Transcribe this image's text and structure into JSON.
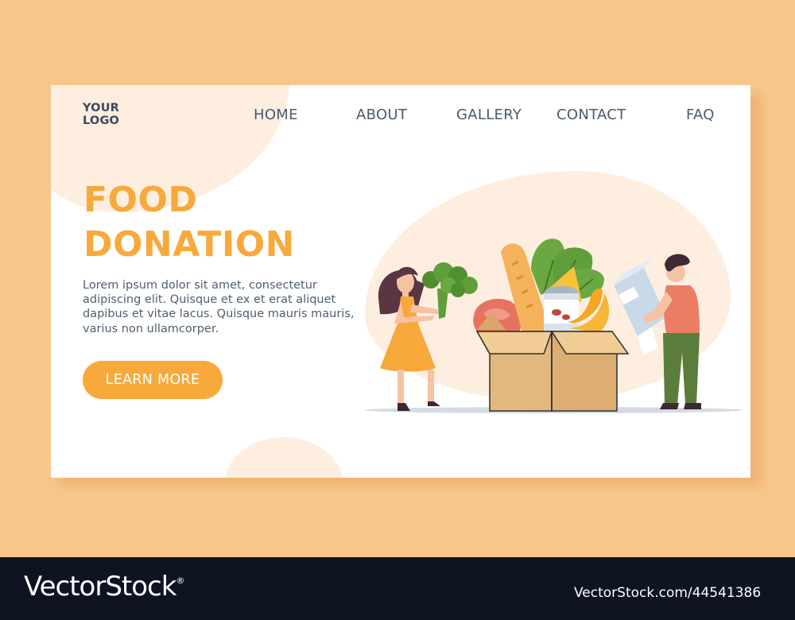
{
  "brand": {
    "logo_line1": "YOUR",
    "logo_line2": "LOGO"
  },
  "nav": {
    "home": "HOME",
    "about": "ABOUT",
    "gallery": "GALLERY",
    "contact": "CONTACT",
    "faq": "FAQ"
  },
  "hero": {
    "title_line1": "FOOD",
    "title_line2": "DONATION",
    "body": "Lorem ipsum dolor sit amet, consectetur adipiscing elit. Quisque et ex et erat aliquet dapibus et vitae lacus. Quisque mauris mauris, varius non ullamcorper.",
    "cta_label": "LEARN MORE"
  },
  "watermark": {
    "brand": "VectorStock",
    "registered": "®",
    "id": "VectorStock.com/44541386"
  },
  "colors": {
    "page_bg": "#f6c68a",
    "accent": "#f8a93b",
    "nav_text": "#4a5a6e",
    "blob": "#fdeee0",
    "footer": "#0f1423"
  },
  "icons": [
    "woman-figure",
    "broccoli-icon",
    "meat-icon",
    "bread-icon",
    "lettuce-icon",
    "cheese-icon",
    "can-icon",
    "banana-icon",
    "milk-carton-icon",
    "man-figure",
    "cardboard-box-icon"
  ]
}
